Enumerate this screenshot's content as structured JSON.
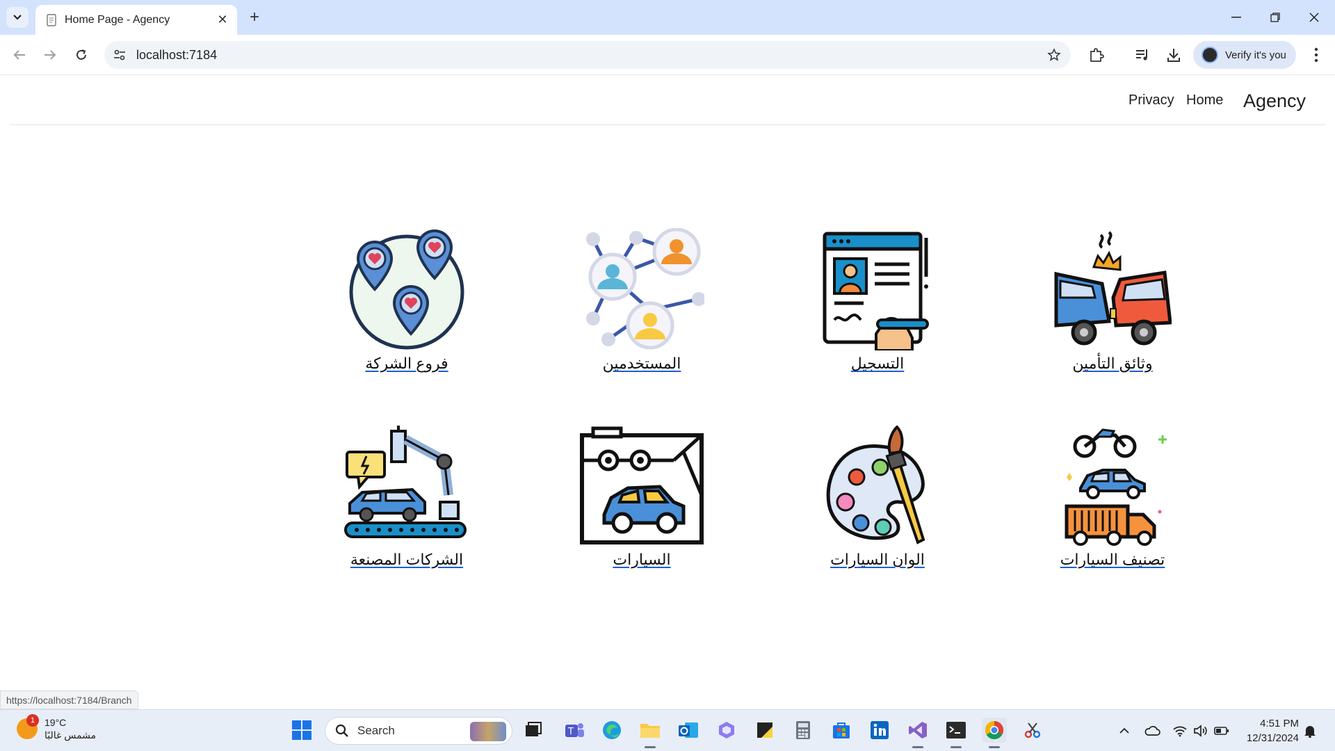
{
  "browser": {
    "tab_title": "Home Page - Agency",
    "tab_close": "✕",
    "new_tab": "+",
    "url": "localhost:7184",
    "verify_label": "Verify it's you"
  },
  "nav": {
    "brand": "Agency",
    "home": "Home",
    "privacy": "Privacy"
  },
  "cards": [
    {
      "label": "فروع الشركة",
      "icon": "map-pins-icon"
    },
    {
      "label": "المستخدمين",
      "icon": "users-network-icon"
    },
    {
      "label": "التسجيل",
      "icon": "registration-form-icon"
    },
    {
      "label": "وثائق التأمين",
      "icon": "car-crash-icon"
    },
    {
      "label": "الشركات المصنعة",
      "icon": "car-factory-icon"
    },
    {
      "label": "السيارات",
      "icon": "car-model-kit-icon"
    },
    {
      "label": "الوان السيارات",
      "icon": "paint-palette-icon"
    },
    {
      "label": "تصنيف السيارات",
      "icon": "vehicle-types-icon"
    }
  ],
  "status_url": "https://localhost:7184/Branch",
  "taskbar": {
    "weather_temp": "19°C",
    "weather_desc": "مشمس غالبًا",
    "weather_badge": "1",
    "search_label": "Search",
    "time": "4:51 PM",
    "date": "12/31/2024"
  }
}
